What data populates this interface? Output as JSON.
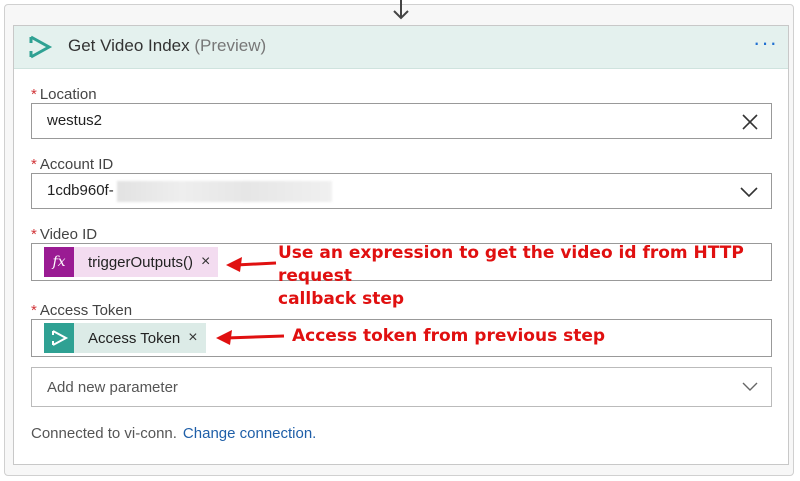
{
  "action": {
    "title": "Get Video Index",
    "title_suffix": "(Preview)",
    "icon": "video-indexer-icon",
    "more_label": "···"
  },
  "fields": {
    "location": {
      "label": "Location",
      "required_mark": "*",
      "value": "westus2"
    },
    "account_id": {
      "label": "Account ID",
      "required_mark": "*",
      "value": "1cdb960f-"
    },
    "video_id": {
      "label": "Video ID",
      "required_mark": "*",
      "token_icon_text": "fx",
      "token_label": "triggerOutputs()",
      "token_remove": "×"
    },
    "access_token": {
      "label": "Access Token",
      "required_mark": "*",
      "token_label": "Access Token",
      "token_remove": "×"
    }
  },
  "add_parameter": {
    "placeholder": "Add new parameter"
  },
  "footer": {
    "connected_text": "Connected to vi-conn.",
    "change_link": "Change connection."
  },
  "annotations": {
    "video_id_note_line1": "Use an expression to get the video id from HTTP request",
    "video_id_note_line2": "callback step",
    "access_token_note": "Access token from previous step"
  },
  "colors": {
    "annotation": "#e01010",
    "header_bg": "#e4f1ee",
    "expression_token": "#9a1b93",
    "dynamic_token": "#2fa193",
    "link": "#1f5fa8"
  }
}
